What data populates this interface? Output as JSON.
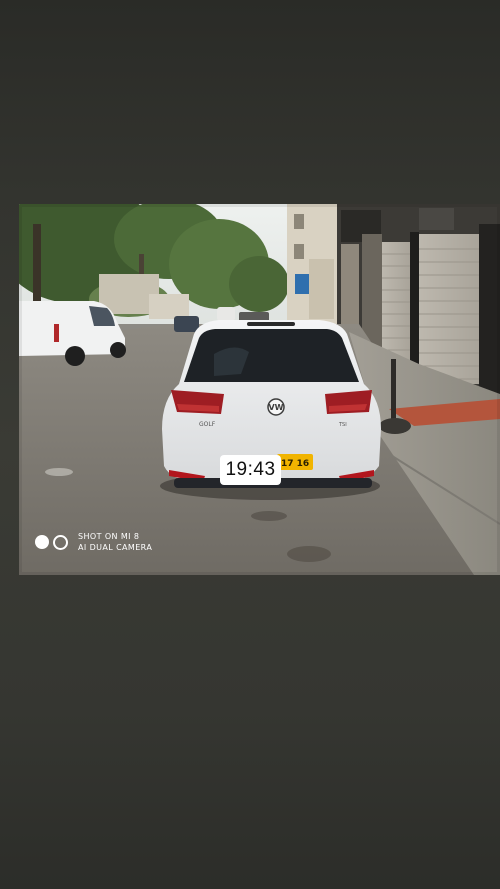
{
  "overlay": {
    "time": "19:43"
  },
  "watermark": {
    "line1": "SHOT ON MI 8",
    "line2": "AI DUAL CAMERA",
    "icon": "camera-lens-dots-icon"
  },
  "photo": {
    "car": {
      "plate_text": "17 16",
      "badge_model": "GOLF",
      "badge_trim": "TSI",
      "brand_logo": "volkswagen-logo-icon"
    }
  },
  "colors": {
    "page_background": "#33342f",
    "timestamp_background": "#ffffff",
    "plate_yellow": "#f1b400"
  }
}
